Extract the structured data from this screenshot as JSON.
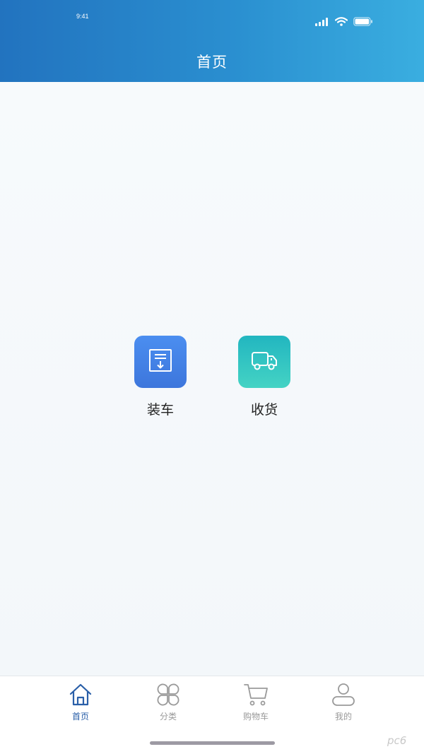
{
  "status_bar": {
    "time": "9:41",
    "icons": [
      "signal-icon",
      "wifi-icon",
      "battery-icon"
    ]
  },
  "nav": {
    "title": "首页"
  },
  "actions": [
    {
      "label": "装车",
      "icon": "load-box-icon",
      "color": "#4b8ef0"
    },
    {
      "label": "收货",
      "icon": "truck-icon",
      "color": "#2cc3c2"
    }
  ],
  "tabbar": {
    "items": [
      {
        "label": "首页",
        "icon": "home-icon",
        "active": true
      },
      {
        "label": "分类",
        "icon": "category-icon",
        "active": false
      },
      {
        "label": "购物车",
        "icon": "cart-icon",
        "active": false
      },
      {
        "label": "我的",
        "icon": "profile-icon",
        "active": false
      }
    ],
    "active_color": "#2a5fa8",
    "inactive_color": "#9a9a9a"
  },
  "colors": {
    "header_start": "#2273bf",
    "header_end": "#3aaee0"
  }
}
